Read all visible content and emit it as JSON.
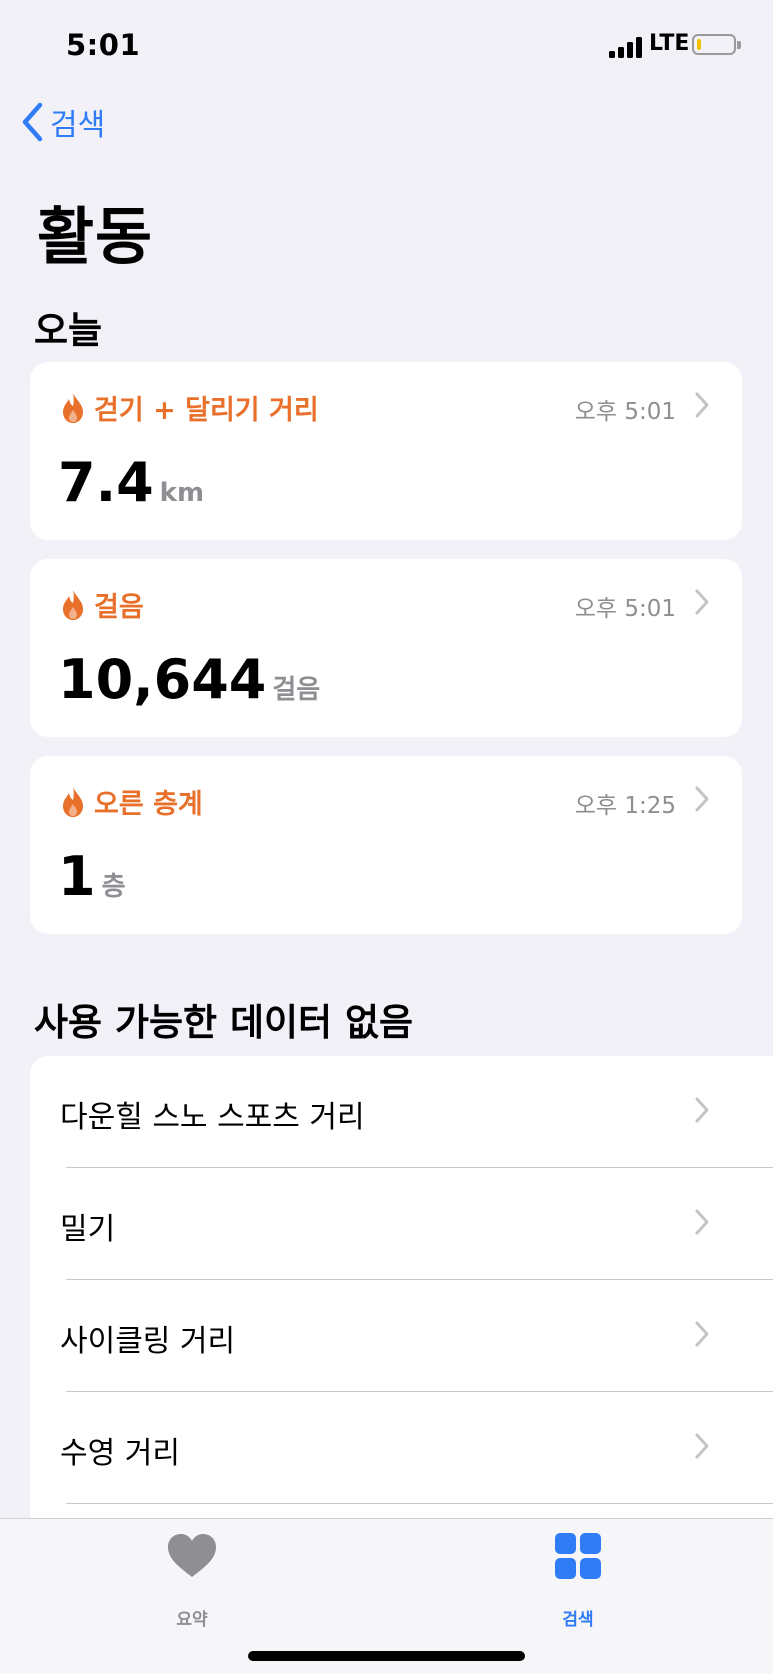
{
  "status": {
    "time": "5:01",
    "network": "LTE"
  },
  "nav": {
    "back_label": "검색"
  },
  "page_title": "활동",
  "today": {
    "section_title": "오늘",
    "cards": [
      {
        "title": "걷기 + 달리기 거리",
        "time": "오후 5:01",
        "value": "7.4",
        "unit": "km"
      },
      {
        "title": "걸음",
        "time": "오후 5:01",
        "value": "10,644",
        "unit": "걸음"
      },
      {
        "title": "오른 층계",
        "time": "오후 1:25",
        "value": "1",
        "unit": "층"
      }
    ]
  },
  "no_data": {
    "section_title": "사용 가능한 데이터 없음",
    "items": [
      {
        "label": "다운힐 스노 스포츠 거리"
      },
      {
        "label": "밀기"
      },
      {
        "label": "사이클링 거리"
      },
      {
        "label": "수영 거리"
      }
    ]
  },
  "tabbar": {
    "tabs": [
      {
        "label": "요약",
        "icon": "heart-icon",
        "active": false,
        "color": "#8e8e93"
      },
      {
        "label": "검색",
        "icon": "grid-icon",
        "active": true,
        "color": "#2f7cf6"
      }
    ]
  },
  "colors": {
    "accent": "#2f7cf6",
    "activity": "#e8702b",
    "background": "#f2f1f7",
    "secondary_text": "#8e8e93"
  }
}
